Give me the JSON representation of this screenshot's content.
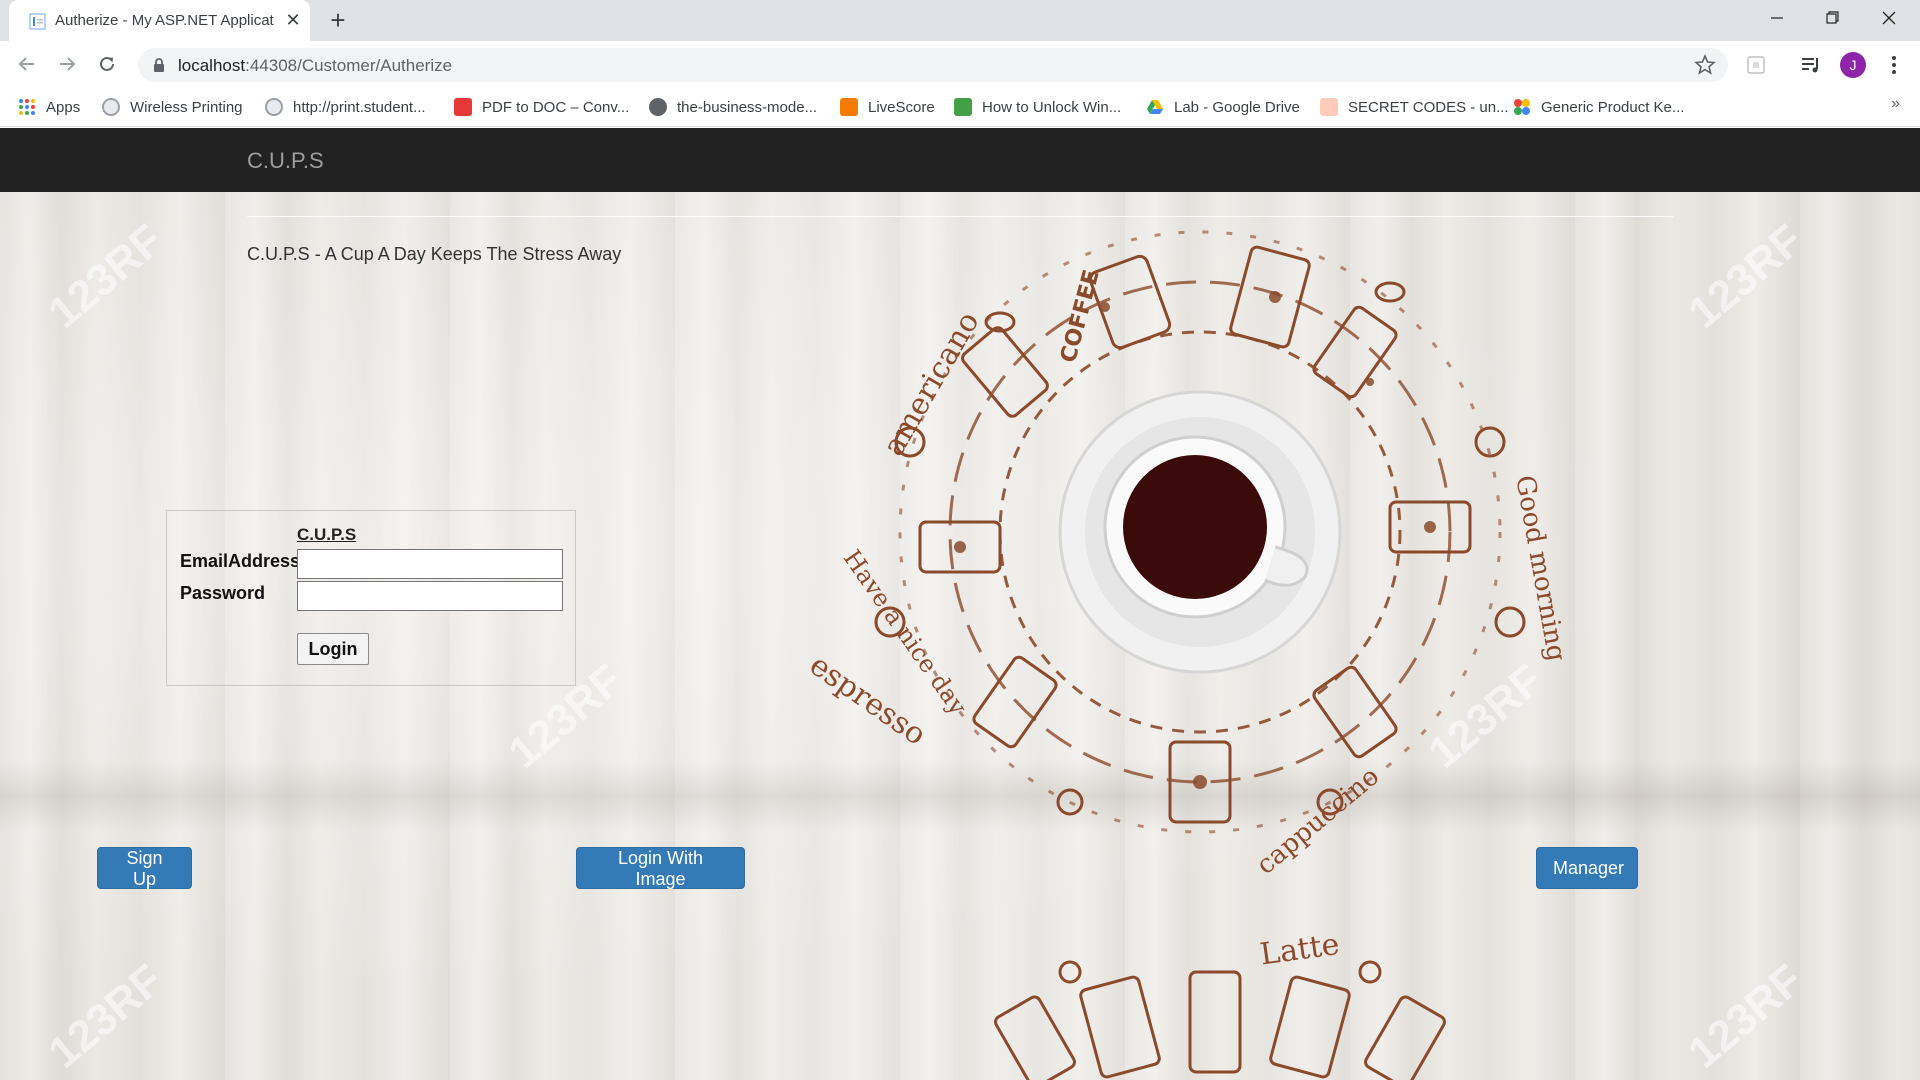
{
  "browser": {
    "tab": {
      "title": "Autherize - My ASP.NET Applicat",
      "close": "✕"
    },
    "new_tab": "+",
    "window": {
      "minimize": "—",
      "maximize": "❐",
      "close": "✕"
    },
    "url": {
      "host": "localhost",
      "path": ":44308/Customer/Autherize"
    },
    "profile_initial": "J",
    "bookmarks": [
      {
        "label": "Apps",
        "color": "#4285f4"
      },
      {
        "label": "Wireless Printing",
        "color": "#9aa0a6"
      },
      {
        "label": "http://print.student...",
        "color": "#9aa0a6"
      },
      {
        "label": "PDF to DOC – Conv...",
        "color": "#e53935"
      },
      {
        "label": "the-business-mode...",
        "color": "#5f6368"
      },
      {
        "label": "LiveScore",
        "color": "#f57c00"
      },
      {
        "label": "How to Unlock Win...",
        "color": "#43a047"
      },
      {
        "label": "Lab - Google Drive",
        "color": "#fbbc04"
      },
      {
        "label": "SECRET CODES - un...",
        "color": "#ffab91"
      },
      {
        "label": "Generic Product Ke...",
        "color": "#34a853"
      }
    ],
    "more_bookmarks": "»"
  },
  "navbar": {
    "brand": "C.U.P.S"
  },
  "main": {
    "tagline": "C.U.P.S - A Cup A Day Keeps The Stress Away",
    "login": {
      "heading": "C.U.P.S",
      "email_label": "EmailAddress",
      "password_label": "Password",
      "email_value": "",
      "password_value": "",
      "login_button": "Login"
    },
    "buttons": {
      "signup": "Sign Up",
      "login_image": "Login With Image",
      "manager": "Manager"
    },
    "doodle_words": {
      "americano": "americano",
      "espresso": "espresso",
      "have_nice_day": "Have a nice day",
      "good_morning": "Good morning",
      "cappuccino": "cappuccino",
      "coffee": "COFFEE",
      "latte": "Latte"
    },
    "watermark": "123RF"
  },
  "colors": {
    "navbar": "#222222",
    "primary": "#337ab7",
    "doodle": "#8b4a2b"
  }
}
